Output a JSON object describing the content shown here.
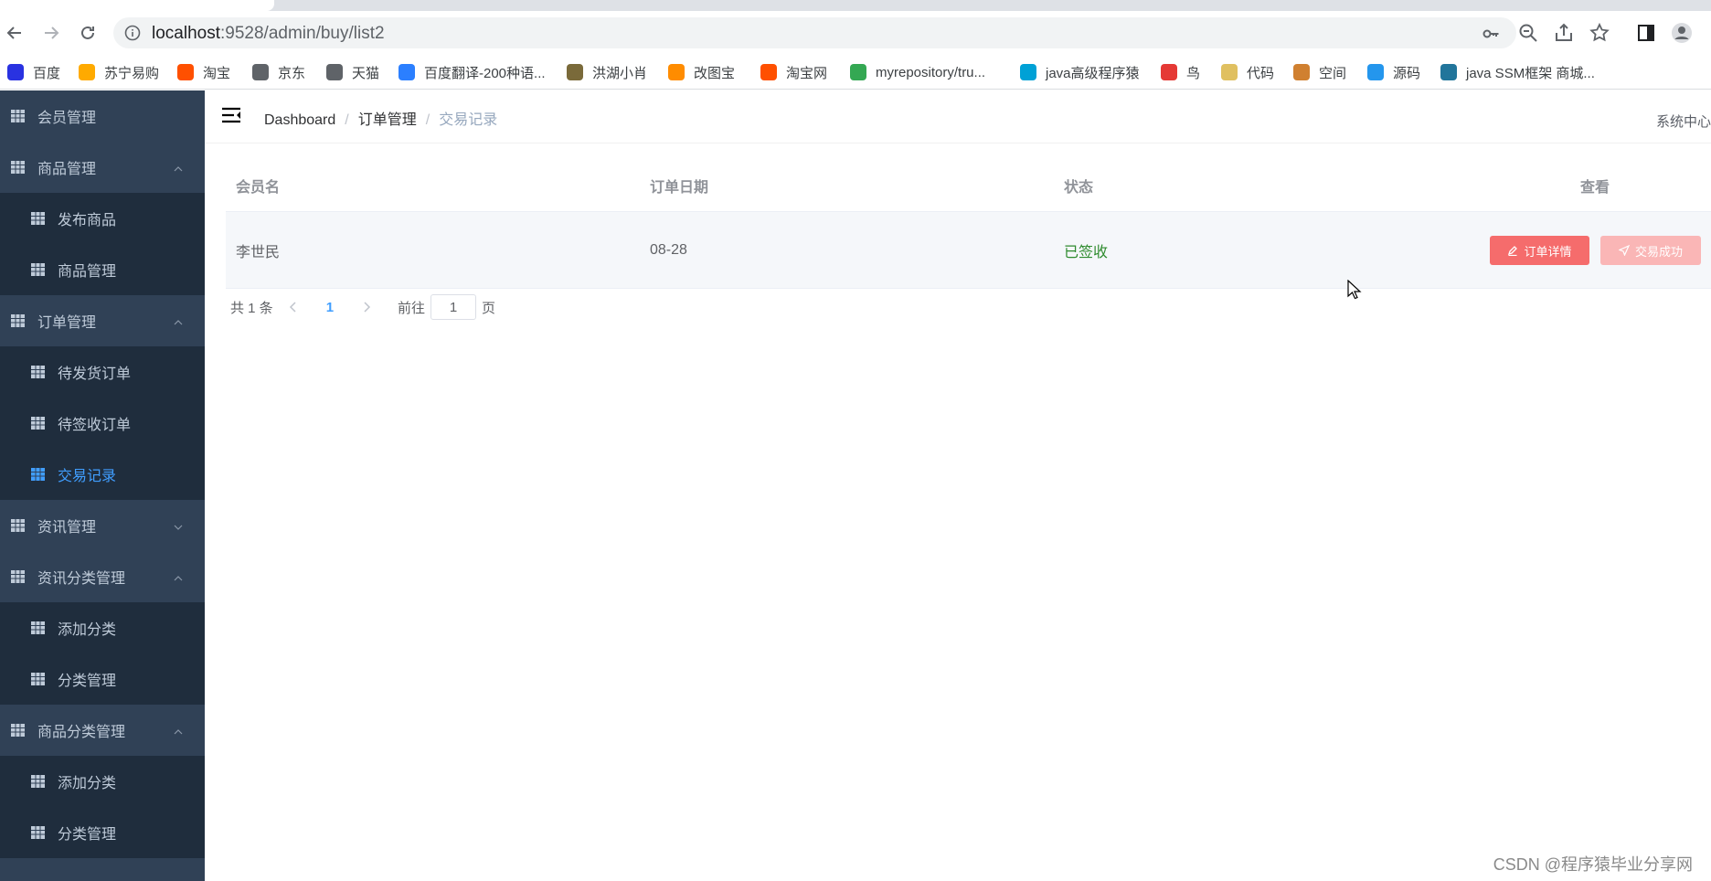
{
  "browser": {
    "url_host": "localhost",
    "url_rest": ":9528/admin/buy/list2",
    "bookmarks": [
      {
        "label": "百度",
        "icon": "baidu-icon",
        "color": "#2932e1"
      },
      {
        "label": "苏宁易购",
        "icon": "suning-icon",
        "color": "#ffaa00"
      },
      {
        "label": "淘宝",
        "icon": "taobao-icon",
        "color": "#ff5000"
      },
      {
        "label": "京东",
        "icon": "globe-icon",
        "color": "#5f6368"
      },
      {
        "label": "天猫",
        "icon": "globe-icon",
        "color": "#5f6368"
      },
      {
        "label": "百度翻译-200种语...",
        "icon": "translate-icon",
        "color": "#2b7fff"
      },
      {
        "label": "洪湖小肖",
        "icon": "bird-icon",
        "color": "#7a6a3a"
      },
      {
        "label": "改图宝",
        "icon": "gaitubao-icon",
        "color": "#ff8c00"
      },
      {
        "label": "淘宝网",
        "icon": "taobao-icon",
        "color": "#ff5000"
      },
      {
        "label": "myrepository/tru...",
        "icon": "chrome-icon",
        "color": "#34a853"
      },
      {
        "label": "java高级程序猿",
        "icon": "bilibili-icon",
        "color": "#00a1d6"
      },
      {
        "label": "鸟",
        "icon": "bird-icon",
        "color": "#e53935"
      },
      {
        "label": "代码",
        "icon": "moon-icon",
        "color": "#e0c060"
      },
      {
        "label": "空间",
        "icon": "qzone-icon",
        "color": "#d08030"
      },
      {
        "label": "源码",
        "icon": "docker-icon",
        "color": "#2496ed"
      },
      {
        "label": "java SSM框架 商城...",
        "icon": "wordpress-icon",
        "color": "#21759b"
      }
    ]
  },
  "sidebar": {
    "items": [
      {
        "label": "会员管理",
        "type": "top",
        "chevron": ""
      },
      {
        "label": "商品管理",
        "type": "top",
        "chevron": "up"
      },
      {
        "label": "发布商品",
        "type": "sub"
      },
      {
        "label": "商品管理",
        "type": "sub"
      },
      {
        "label": "订单管理",
        "type": "top",
        "chevron": "up"
      },
      {
        "label": "待发货订单",
        "type": "sub"
      },
      {
        "label": "待签收订单",
        "type": "sub"
      },
      {
        "label": "交易记录",
        "type": "sub",
        "active": true
      },
      {
        "label": "资讯管理",
        "type": "top",
        "chevron": "down"
      },
      {
        "label": "资讯分类管理",
        "type": "top",
        "chevron": "up"
      },
      {
        "label": "添加分类",
        "type": "sub"
      },
      {
        "label": "分类管理",
        "type": "sub"
      },
      {
        "label": "商品分类管理",
        "type": "top",
        "chevron": "up"
      },
      {
        "label": "添加分类",
        "type": "sub"
      },
      {
        "label": "分类管理",
        "type": "sub"
      }
    ],
    "active_color": "#409eff"
  },
  "navbar": {
    "breadcrumb": [
      "Dashboard",
      "订单管理",
      "交易记录"
    ],
    "right_label": "系统中心"
  },
  "table": {
    "columns": [
      "会员名",
      "订单日期",
      "状态",
      "查看"
    ],
    "rows": [
      {
        "member": "李世民",
        "date": "08-28",
        "status": "已签收",
        "detail_btn": "订单详情",
        "success_btn": "交易成功"
      }
    ]
  },
  "pagination": {
    "total": "共 1 条",
    "current": "1",
    "goto_label": "前往",
    "goto_value": "1",
    "page_label": "页"
  },
  "watermark": "CSDN @程序猿毕业分享网"
}
